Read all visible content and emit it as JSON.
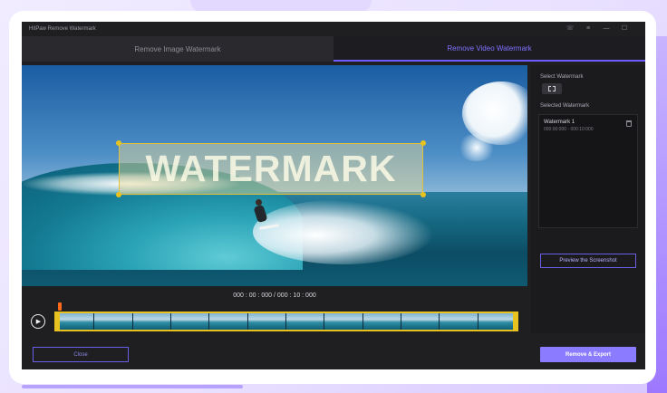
{
  "window": {
    "title": "HitPaw Remove Watermark",
    "controls": [
      "phone-icon",
      "menu-icon",
      "minimize-icon",
      "maximize-icon"
    ]
  },
  "tabs": [
    {
      "label": "Remove Image Watermark",
      "active": false
    },
    {
      "label": "Remove Video Watermark",
      "active": true
    }
  ],
  "video": {
    "watermark_text": "WATERMARK",
    "timecode": "000 : 00 : 000 / 000 : 10 : 000"
  },
  "right_panel": {
    "select_label": "Select Watermark",
    "selected_label": "Selected Watermark",
    "item_name": "Watermark 1",
    "item_time": "000:00:000 - 000:10:000",
    "preview_button": "Preview the Screenshot"
  },
  "footer": {
    "close_button": "Close",
    "export_button": "Remove & Export"
  },
  "colors": {
    "accent": "#6f5cff",
    "export": "#8b7bff",
    "selection": "#e8c21e",
    "playhead": "#ff6a1a"
  }
}
